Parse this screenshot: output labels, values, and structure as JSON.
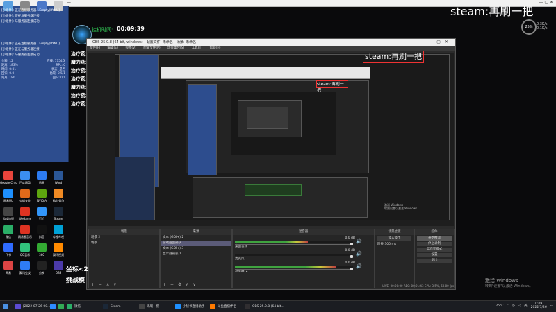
{
  "background_window": {
    "title": "—"
  },
  "left_overlay": {
    "log": [
      "[小组件]: 正在连接服务器...Empty(RYNU]",
      "[小组件]: 正在与服务器连接",
      "[小组件]: 与服务器连接成功",
      "[小组件]: 正在连接服务器...Empty(RYNU]",
      "[小组件]: 正在与服务器连接",
      "[小组件]: 与服务器连接成功"
    ],
    "stats": [
      [
        "金额: 12",
        "在线: 1754次"
      ],
      [
        "距离: 183%",
        "RPL: 0"
      ],
      [
        "时间: 0:01",
        "状态: 是否"
      ],
      [
        "回归: 0.0",
        "比较: 0.5/1"
      ],
      [
        "距离: 180",
        "回归: 0/1"
      ]
    ]
  },
  "game_overlay": {
    "timer_label": "挂机时间:",
    "timer_value": "00:09:39",
    "buffs": [
      "治疗药水",
      "魔力药水",
      "治疗药水",
      "治疗药水",
      "魔力药水",
      "治疗药水",
      "治疗药水"
    ],
    "bottom_lines": [
      "坐标<2",
      "挑战模"
    ],
    "steam_text": "steam:再刷一把",
    "perf_percent": "25%",
    "perf_lines": [
      "0.3K/s",
      "0.1K/s"
    ]
  },
  "obs": {
    "title": "OBS 25.0.8 (64 bit, windows) - 配置文件: 未命名 - 场景: 未命名",
    "menu": [
      "文件(F)",
      "编辑(E)",
      "视图(V)",
      "配置文件(P)",
      "场景集合(S)",
      "工具(T)",
      "帮助(H)"
    ],
    "preview_steam_text": "steam:再刷一把",
    "preview_activate": [
      "激活 Windows",
      "转到设置以激活 Windows"
    ],
    "docks": {
      "scenes": {
        "header": "场景",
        "items": [
          "场景 2",
          "场景"
        ]
      },
      "sources": {
        "header": "来源",
        "items": [
          "文本 (GDI+) 2",
          "游戏画面捕获",
          "文本 (GDI+) 3",
          "显示器捕获 1"
        ]
      },
      "mixer": {
        "header": "混音器",
        "channels": [
          {
            "name": "桌面音频",
            "db": "0.0 dB",
            "level": 0.62
          },
          {
            "name": "麦克风",
            "db": "0.0 dB",
            "level": 0.0
          },
          {
            "name": "浏览器_2",
            "db": "0.0 dB",
            "level": 0.85
          }
        ]
      },
      "transitions": {
        "header": "场景过渡",
        "type": "淡入淡出",
        "duration_label": "时长",
        "duration": "300 ms"
      },
      "controls": {
        "header": "控件",
        "buttons": [
          "开始推流",
          "停止录制",
          "工作室模式",
          "设置",
          "退出"
        ]
      }
    },
    "status": "LIVE: 00:00:00   REC: 00:01:43   CPU: 3.5%, 60.00 fps"
  },
  "desktop_icons": [
    {
      "label": "Google Chrome",
      "color": "#e8453c"
    },
    {
      "label": "百度网盘",
      "color": "#3b8ef0"
    },
    {
      "label": "迅雷",
      "color": "#2d7cf2"
    },
    {
      "label": "Word",
      "color": "#2b5797"
    },
    {
      "label": "网易UU",
      "color": "#1e90ff"
    },
    {
      "label": "火绒安全",
      "color": "#e06a1a"
    },
    {
      "label": "NVIDIA",
      "color": "#5ea50f"
    },
    {
      "label": "Half-Life",
      "color": "#f08a24"
    },
    {
      "label": "游戏加速",
      "color": "#444"
    },
    {
      "label": "WeGame",
      "color": "#d32"
    },
    {
      "label": "钉钉",
      "color": "#3296fa"
    },
    {
      "label": "Steam",
      "color": "#1b2838"
    },
    {
      "label": "微信",
      "color": "#2aae67"
    },
    {
      "label": "网易云音乐",
      "color": "#d32"
    },
    {
      "label": "抖音",
      "color": "#111"
    },
    {
      "label": "哔哩哔哩",
      "color": "#00a1d6"
    },
    {
      "label": "飞书",
      "color": "#2f6bff"
    },
    {
      "label": "QQ音乐",
      "color": "#31c27c"
    },
    {
      "label": "360",
      "color": "#3a3"
    },
    {
      "label": "腾讯视频",
      "color": "#ff8a00"
    },
    {
      "label": "网易",
      "color": "#d44"
    },
    {
      "label": "腾讯会议",
      "color": "#2e7cf6"
    },
    {
      "label": "剪映",
      "color": "#222"
    },
    {
      "label": "OBS",
      "color": "#4b3aa8"
    }
  ],
  "taskbar": {
    "items": [
      {
        "label": "",
        "color": "#4a90e2"
      },
      {
        "label": "[2022-07-26 00...",
        "color": "#5c4bd2"
      },
      {
        "label": "",
        "color": "#2e8bff"
      },
      {
        "label": "",
        "color": "#33aa55"
      },
      {
        "label": "微信",
        "color": "#2aae67"
      },
      {
        "label": "Steam",
        "color": "#1b2838"
      },
      {
        "label": "再刷一把",
        "color": "#444"
      },
      {
        "label": "小秘书直播助手",
        "color": "#1e90ff"
      },
      {
        "label": "斗鱼直播伴侣",
        "color": "#ff7a00"
      },
      {
        "label": "OBS 25.0.8 (64 bit...",
        "color": "#302e31"
      }
    ],
    "tray_temp": "25°C",
    "tray_ime": "英",
    "time": "0:09",
    "date": "2022/7/26"
  },
  "activate_windows": {
    "title": "激活 Windows",
    "sub": "转到\"设置\"以激活 Windows。"
  }
}
